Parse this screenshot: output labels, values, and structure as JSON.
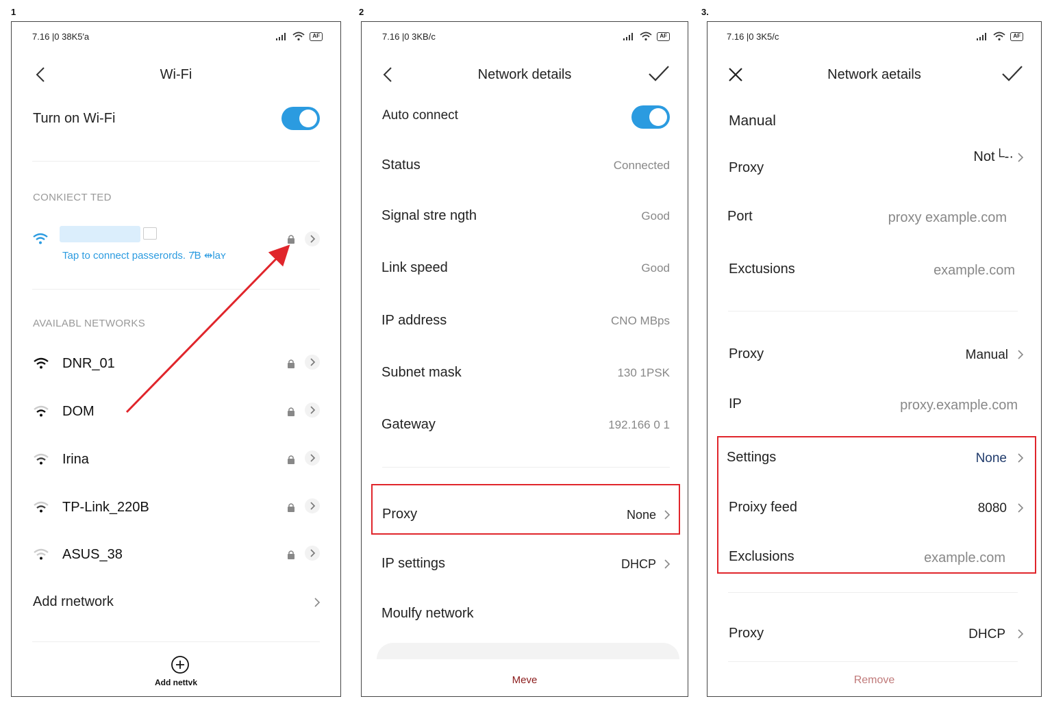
{
  "steps": [
    "1",
    "2",
    "3."
  ],
  "panel1": {
    "status_time": "7.16 |0 38K5′a",
    "title": "Wi-Fi",
    "toggle_label": "Turn on Wi-Fi",
    "connected_header": "CONKIECT TED",
    "connected_sub": "Tap to connect passerords. 7̆̈B ⇹laʏ",
    "available_header": "AVAILABL NETWORKS",
    "networks": [
      "DNR_01",
      "DOM",
      "Irina",
      "TP-Link_220B",
      "ASUS_38"
    ],
    "add_network": "Add rnetwork",
    "bottom_label": "Add nettvk"
  },
  "panel2": {
    "status_time": "7.16 |0 3KB/c",
    "title": "Network details",
    "auto_connect": "Auto connect",
    "rows": [
      {
        "label": "Status",
        "value": "Connected"
      },
      {
        "label": "Signal stre ngth",
        "value": "Good"
      },
      {
        "label": "Link speed",
        "value": "Good"
      },
      {
        "label": "IP address",
        "value": "CNO MBps"
      },
      {
        "label": "Subnet mask",
        "value": "130 1PSK"
      },
      {
        "label": "Gateway",
        "value": "192.166 0 1"
      }
    ],
    "proxy_label": "Proxy",
    "proxy_value": "None",
    "ip_settings_label": "IP settings",
    "ip_settings_value": "DHCP",
    "modify_label": "Moulfy network",
    "bottom_label": "Meve"
  },
  "panel3": {
    "status_time": "7.16 |0 3K5/c",
    "title": "Network aetails",
    "manual": "Manual",
    "rows_top": [
      {
        "label": "Proxy",
        "value": "Not└‐·"
      },
      {
        "label": "Port",
        "value": "proxy example.com"
      },
      {
        "label": "Exctusions",
        "value": "example.com"
      }
    ],
    "rows_mid": [
      {
        "label": "Proxy",
        "value": "Manual"
      },
      {
        "label": "IP",
        "value": "proxy.example.com"
      }
    ],
    "rows_box": [
      {
        "label": "Settings",
        "value": "None"
      },
      {
        "label": "Proixy feed",
        "value": "8080"
      },
      {
        "label": "Exclusions",
        "value": "example.com"
      }
    ],
    "proxy_dhcp_label": "Proxy",
    "proxy_dhcp_value": "DHCP",
    "bottom_label": "Remove"
  },
  "colors": {
    "accent": "#2b9be0",
    "highlight": "#e0252b",
    "remove": "#c07a7a",
    "move": "#8b1c1c"
  }
}
